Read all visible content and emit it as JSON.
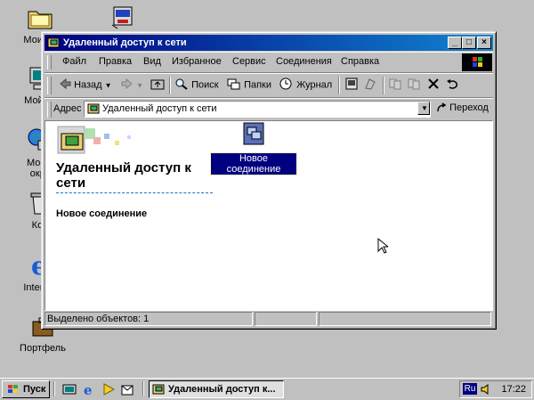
{
  "desktop": {
    "icons": [
      {
        "label": "Мои до"
      },
      {
        "label": ""
      },
      {
        "label": "Мой ко"
      },
      {
        "label": "Мое с\nокру"
      },
      {
        "label": "Кор"
      },
      {
        "label": "Internet"
      },
      {
        "label": "Портфель"
      }
    ]
  },
  "window": {
    "title": "Удаленный доступ к сети",
    "menu": [
      "Файл",
      "Правка",
      "Вид",
      "Избранное",
      "Сервис",
      "Соединения",
      "Справка"
    ],
    "toolbar": {
      "back": "Назад",
      "search": "Поиск",
      "folders": "Папки",
      "journal": "Журнал"
    },
    "address": {
      "label": "Адрес",
      "value": "Удаленный доступ к сети",
      "go": "Переход"
    },
    "content": {
      "heading": "Удаленный доступ к сети",
      "subheading": "Новое соединение",
      "items": [
        {
          "label": "Новое соединение"
        }
      ]
    },
    "status": {
      "selected": "Выделено объектов: 1"
    }
  },
  "taskbar": {
    "start": "Пуск",
    "task": "Удаленный доступ к...",
    "lang": "Ru",
    "clock": "17:22"
  },
  "colors": {
    "desktop": "#c0c0c0",
    "titlebar_start": "#000080",
    "titlebar_end": "#1084d0",
    "selection": "#000080"
  }
}
